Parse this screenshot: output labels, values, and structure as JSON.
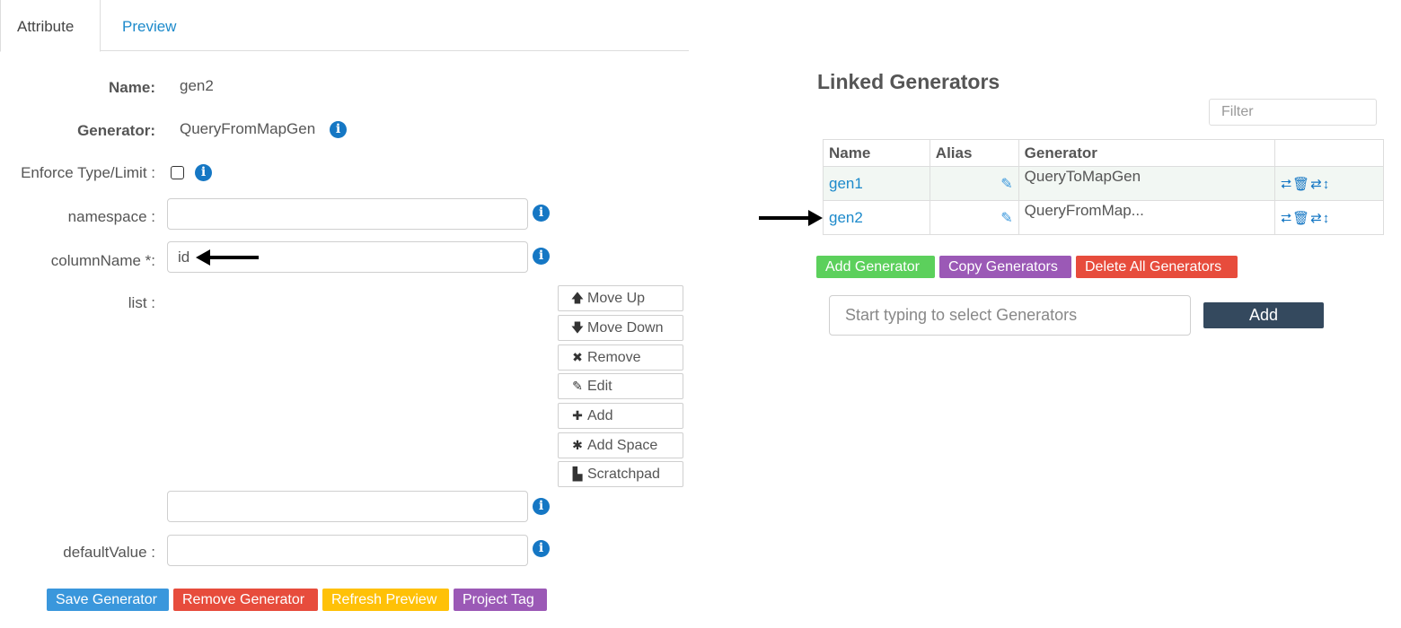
{
  "tabs": [
    {
      "label": "Attribute",
      "active": true
    },
    {
      "label": "Preview",
      "active": false
    }
  ],
  "form": {
    "name_label": "Name:",
    "name_value": "gen2",
    "generator_label": "Generator:",
    "generator_value": "QueryFromMapGen",
    "enforce_label": "Enforce Type/Limit :",
    "enforce_checked": false,
    "namespace_label": "namespace :",
    "namespace_value": "",
    "columnname_label": "columnName *:",
    "columnname_value": "id",
    "list_label": "list :",
    "list_input_value": "",
    "defaultvalue_label": "defaultValue :",
    "defaultvalue_value": ""
  },
  "list_buttons": [
    {
      "label": "Move Up",
      "icon": "arrow-up-icon",
      "glyph": "🡅"
    },
    {
      "label": "Move Down",
      "icon": "arrow-down-icon",
      "glyph": "🡇"
    },
    {
      "label": "Remove",
      "icon": "times-icon",
      "glyph": "✖"
    },
    {
      "label": "Edit",
      "icon": "pencil-icon",
      "glyph": "✎"
    },
    {
      "label": "Add",
      "icon": "plus-icon",
      "glyph": "✚"
    },
    {
      "label": "Add Space",
      "icon": "asterisk-icon",
      "glyph": "✱"
    },
    {
      "label": "Scratchpad",
      "icon": "file-icon",
      "glyph": "▙"
    }
  ],
  "bottom_buttons": {
    "save": "Save Generator",
    "remove": "Remove Generator",
    "refresh": "Refresh Preview",
    "project_tag": "Project Tag"
  },
  "linked": {
    "title": "Linked Generators",
    "filter_placeholder": "Filter",
    "columns": [
      "Name",
      "Alias",
      "Generator",
      ""
    ],
    "rows": [
      {
        "name": "gen1",
        "alias": "",
        "generator": "QueryToMapGen"
      },
      {
        "name": "gen2",
        "alias": "",
        "generator": "QueryFromMap..."
      }
    ],
    "add_generator": "Add Generator",
    "copy_generators": "Copy Generators",
    "delete_all": "Delete All Generators",
    "select_placeholder": "Start typing to select Generators",
    "add_button": "Add"
  },
  "colors": {
    "accent_link": "#1d8acb",
    "save": "#3a97dc",
    "remove": "#e74c3c",
    "refresh": "#ffc107",
    "project_tag": "#9b59b6",
    "add_generator": "#5cd05c",
    "add_dark": "#34495e"
  }
}
